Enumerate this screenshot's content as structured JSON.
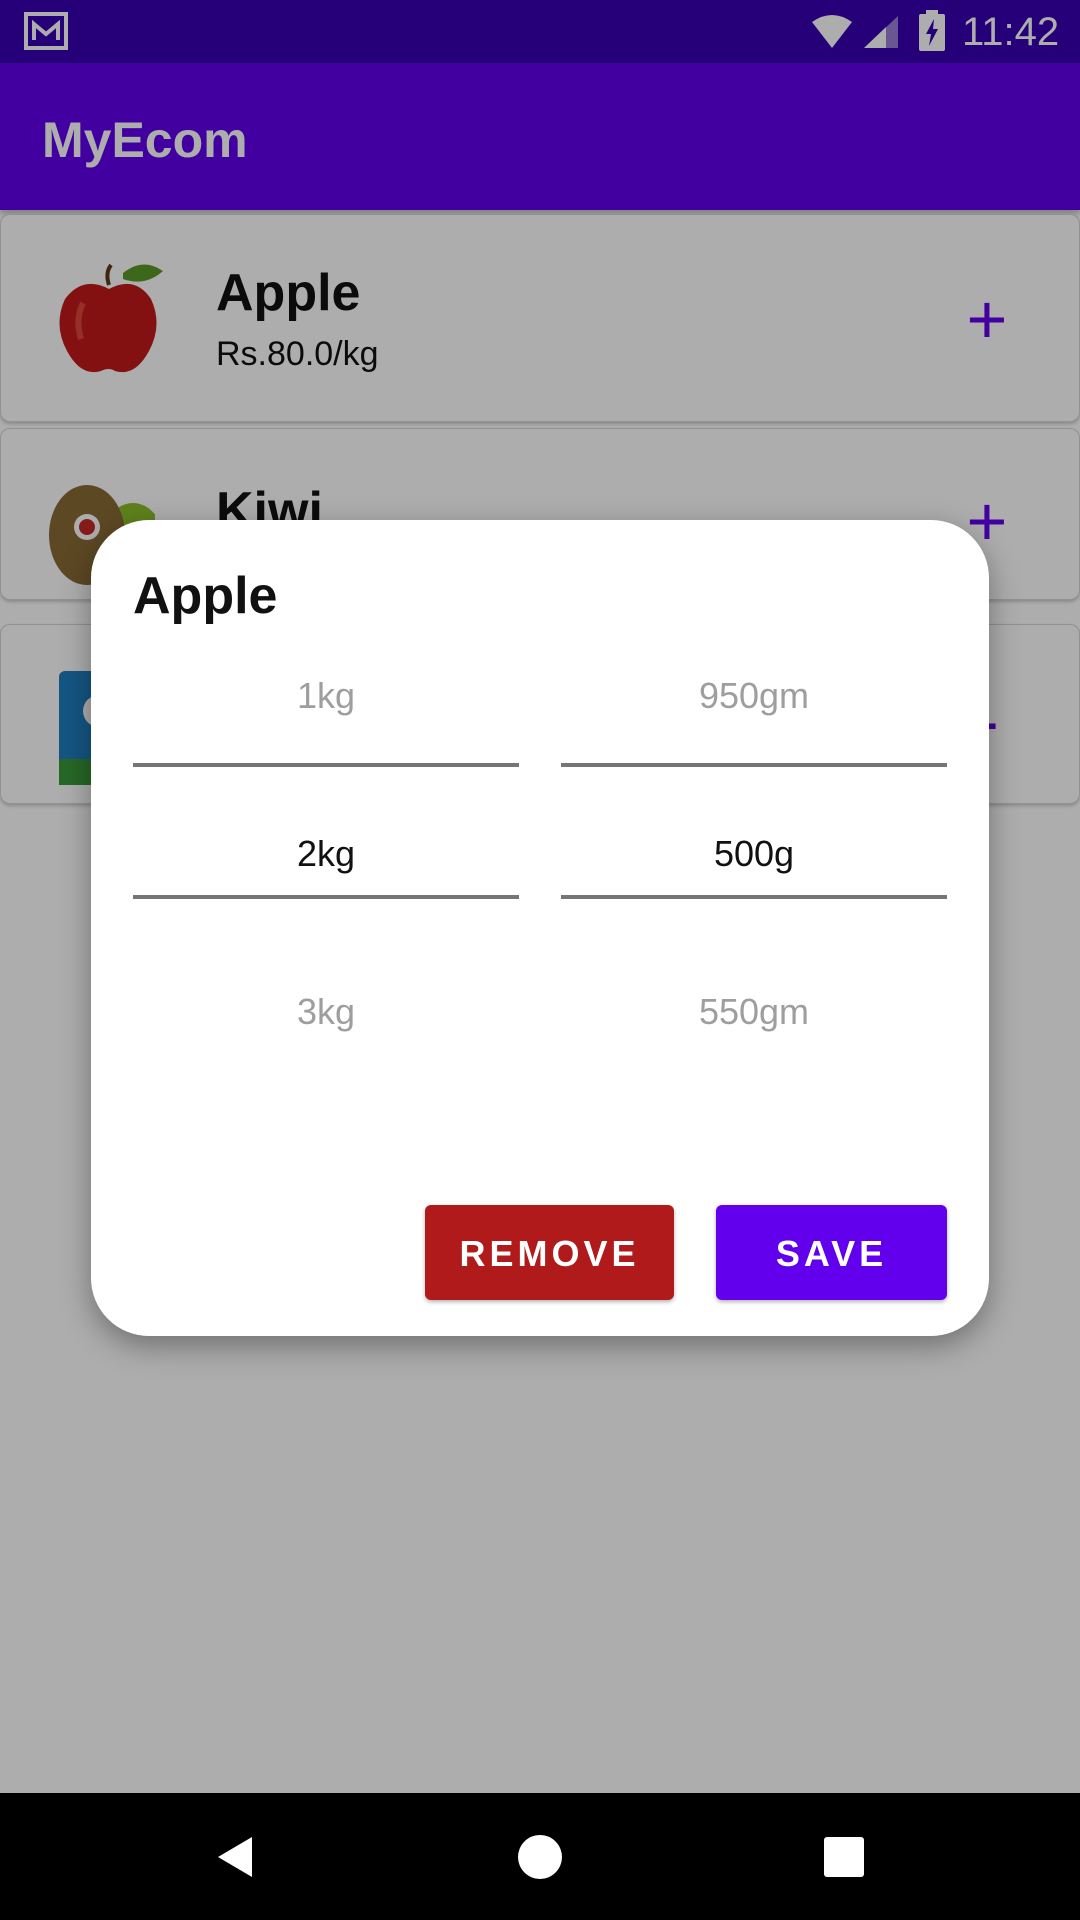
{
  "status_bar": {
    "time": "11:42",
    "icons": [
      "gmail-icon",
      "wifi-icon",
      "signal-icon",
      "battery-charging-icon"
    ]
  },
  "app_bar": {
    "title": "MyEcom"
  },
  "products": [
    {
      "name": "Apple",
      "price": "Rs.80.0/kg",
      "image": "apple-icon",
      "action": "+"
    },
    {
      "name": "Kiwi",
      "image": "kiwi-icon",
      "action": "+"
    },
    {
      "image": "grocery-pack-icon",
      "action": "-"
    }
  ],
  "dialog": {
    "title": "Apple",
    "kg_picker": {
      "above": "1kg",
      "selected": "2kg",
      "below": "3kg"
    },
    "gram_picker": {
      "above": "950gm",
      "selected": "500g",
      "below": "550gm"
    },
    "remove_label": "REMOVE",
    "save_label": "SAVE"
  },
  "colors": {
    "primary": "#6200ee",
    "status_bar": "#3700b3",
    "remove": "#b01a1a"
  },
  "nav_bar": {
    "icons": [
      "back-icon",
      "home-icon",
      "recents-icon"
    ]
  }
}
